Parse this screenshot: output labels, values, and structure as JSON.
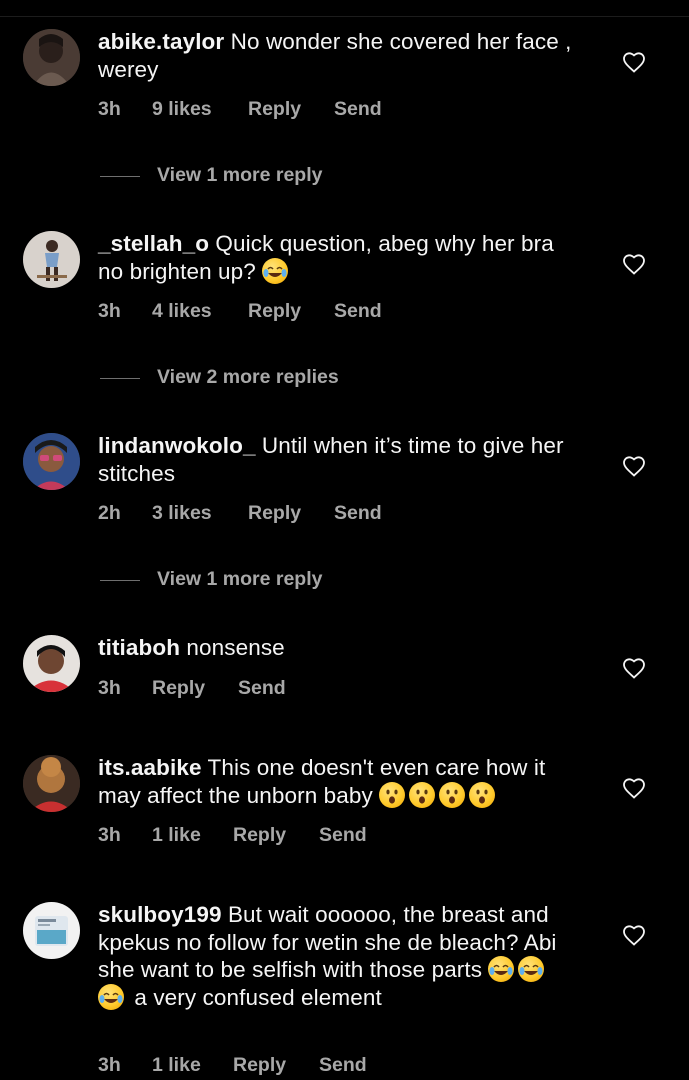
{
  "comments": [
    {
      "username": "abike.taylor",
      "text": "No wonder she covered her face , werey",
      "time": "3h",
      "likes": "9 likes",
      "reply": "Reply",
      "send": "Send",
      "view_more": "View 1 more reply"
    },
    {
      "username": "_stellah_o",
      "text": "Quick question, abeg why her bra no brighten up?",
      "emojis": [
        "face-with-tears-of-joy"
      ],
      "time": "3h",
      "likes": "4 likes",
      "reply": "Reply",
      "send": "Send",
      "view_more": "View 2 more replies"
    },
    {
      "username": "lindanwokolo_",
      "text": "Until when it’s time to give her stitches",
      "time": "2h",
      "likes": "3 likes",
      "reply": "Reply",
      "send": "Send",
      "view_more": "View 1 more reply"
    },
    {
      "username": "titiaboh",
      "text": "nonsense",
      "time": "3h",
      "reply": "Reply",
      "send": "Send"
    },
    {
      "username": "its.aabike",
      "text": "This one doesn't even care how it may affect the unborn baby",
      "emojis": [
        "hushed-face",
        "hushed-face",
        "hushed-face",
        "hushed-face"
      ],
      "time": "3h",
      "likes": "1 like",
      "reply": "Reply",
      "send": "Send"
    },
    {
      "username": "skulboy199",
      "text": "But wait oooooo, the breast and kpekus no follow for wetin she de bleach? Abi she want to be selfish with those parts",
      "emojis": [
        "face-with-tears-of-joy",
        "face-with-tears-of-joy",
        "face-with-tears-of-joy"
      ],
      "text_after": "a very confused element",
      "time": "3h",
      "likes": "1 like",
      "reply": "Reply",
      "send": "Send"
    }
  ],
  "icons": {
    "like": "heart-outline-icon"
  },
  "colors": {
    "background": "#000000",
    "text": "#f5f5f5",
    "muted": "#a8a8a8"
  }
}
